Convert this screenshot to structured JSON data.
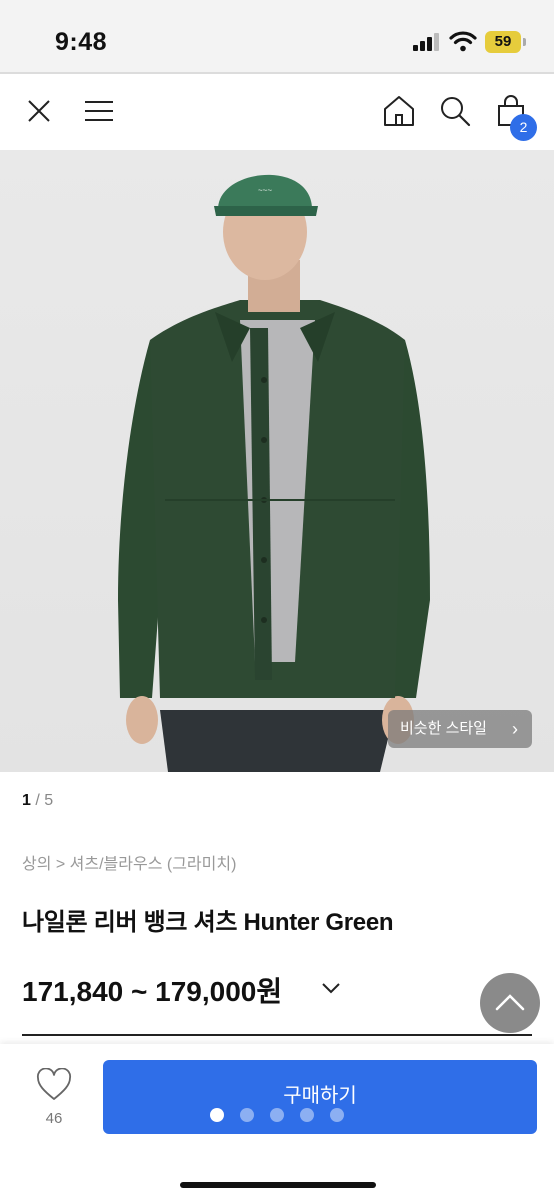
{
  "status_bar": {
    "time": "9:48",
    "battery": "59"
  },
  "header": {
    "cart_count": "2"
  },
  "gallery": {
    "current": "1",
    "separator": " / ",
    "total": "5",
    "similar_style_label": "비슷한 스타일"
  },
  "product": {
    "breadcrumb": "상의 > 셔츠/블라우스 (그라미치)",
    "title": "나일론 리버 뱅크 셔츠 Hunter Green",
    "price": "171,840 ~ 179,000원"
  },
  "bottom_bar": {
    "like_count": "46",
    "buy_label": "구매하기",
    "page_dots": 5,
    "active_dot": 0
  },
  "colors": {
    "accent": "#2f6ee8",
    "jacket": "#2e4a33"
  }
}
